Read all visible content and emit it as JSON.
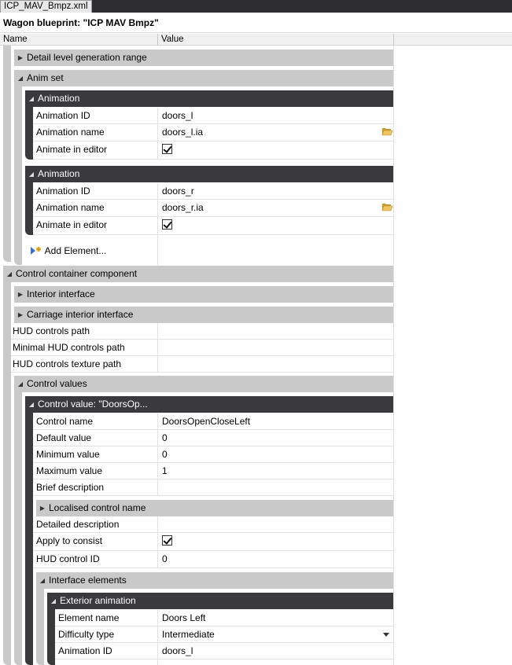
{
  "tab": {
    "label": "ICP_MAV_Bmpz.xml"
  },
  "title": "Wagon blueprint: \"ICP MAV Bmpz\"",
  "columns": {
    "name": "Name",
    "value": "Value"
  },
  "anim_group": {
    "detail_level": "Detail level generation range",
    "anim_set": "Anim set",
    "animations": [
      {
        "header": "Animation",
        "id_label": "Animation ID",
        "id_value": "doors_l",
        "name_label": "Animation name",
        "name_value": "doors_l.ia",
        "editor_label": "Animate in editor"
      },
      {
        "header": "Animation",
        "id_label": "Animation ID",
        "id_value": "doors_r",
        "name_label": "Animation name",
        "name_value": "doors_r.ia",
        "editor_label": "Animate in editor"
      }
    ],
    "add_element": "Add Element..."
  },
  "control": {
    "header": "Control container component",
    "interior_interface": "Interior interface",
    "carriage_interior_interface": "Carriage interior interface",
    "hud_controls_path": "HUD controls path",
    "min_hud_controls_path": "Minimal HUD controls path",
    "hud_controls_texture_path": "HUD controls texture path",
    "control_values": "Control values",
    "control_value_header": "Control value: \"DoorsOp...",
    "fields": {
      "control_name_label": "Control name",
      "control_name_value": "DoorsOpenCloseLeft",
      "default_label": "Default value",
      "default_value": "0",
      "min_label": "Minimum value",
      "min_value": "0",
      "max_label": "Maximum value",
      "max_value": "1",
      "brief_label": "Brief description",
      "localised": "Localised control name",
      "detailed_label": "Detailed description",
      "apply_label": "Apply to consist",
      "hud_id_label": "HUD control ID",
      "hud_id_value": "0"
    },
    "interface_elements": "Interface elements",
    "exterior_animation": "Exterior animation",
    "exterior": {
      "element_name_label": "Element name",
      "element_name_value": "Doors Left",
      "difficulty_label": "Difficulty type",
      "difficulty_value": "Intermediate",
      "anim_id_label": "Animation ID",
      "anim_id_value": "doors_l"
    }
  },
  "colors": {
    "group_light": "#c9c9c9",
    "group_dark": "#3a3a3d",
    "folder": "#e8b84a"
  }
}
